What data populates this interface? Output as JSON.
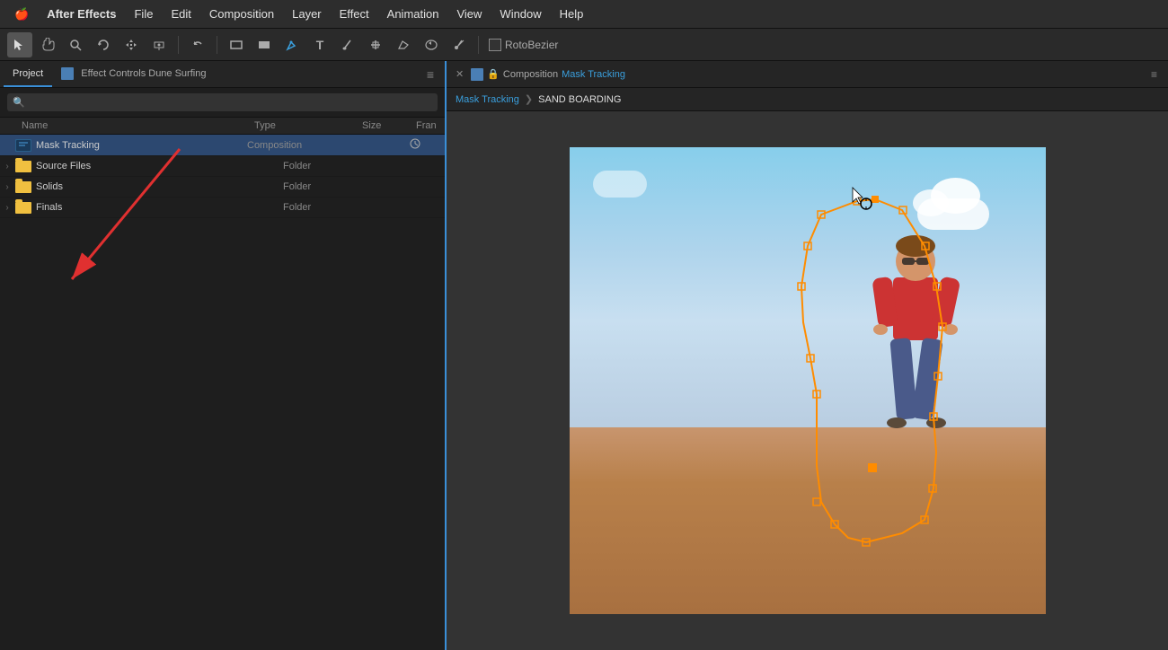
{
  "menubar": {
    "apple": "🍎",
    "app_name": "After Effects",
    "menus": [
      "File",
      "Edit",
      "Composition",
      "Layer",
      "Effect",
      "Animation",
      "View",
      "Window",
      "Help"
    ]
  },
  "toolbar": {
    "tools": [
      {
        "name": "selection-tool",
        "icon": "▲",
        "active": true
      },
      {
        "name": "hand-tool",
        "icon": "✋"
      },
      {
        "name": "zoom-tool",
        "icon": "🔍"
      },
      {
        "name": "rotate-tool",
        "icon": "↺"
      },
      {
        "name": "pan-tool",
        "icon": "✛"
      },
      {
        "name": "camera-tool",
        "icon": "⬇"
      },
      {
        "name": "undo-tool",
        "icon": "↩"
      },
      {
        "name": "rect-tool",
        "icon": "⬜"
      },
      {
        "name": "shape-tool",
        "icon": "◼"
      },
      {
        "name": "pen-tool",
        "icon": "✒"
      },
      {
        "name": "text-tool",
        "icon": "T"
      },
      {
        "name": "brush-tool",
        "icon": "/"
      },
      {
        "name": "clone-tool",
        "icon": "⌅"
      },
      {
        "name": "eraser-tool",
        "icon": "◇"
      },
      {
        "name": "roto-tool",
        "icon": "✦"
      },
      {
        "name": "pin-tool",
        "icon": "📌"
      }
    ],
    "roto_bezier": {
      "label": "RotoBezier",
      "checked": false
    }
  },
  "left_panel": {
    "tabs": [
      {
        "id": "project",
        "label": "Project",
        "active": true
      },
      {
        "id": "effect-controls",
        "label": "Effect Controls Dune Surfing"
      }
    ],
    "project": {
      "search_placeholder": "🔍",
      "columns": {
        "name": "Name",
        "type": "Type",
        "size": "Size",
        "fran": "Fran"
      },
      "items": [
        {
          "id": "mask-tracking",
          "name": "Mask Tracking",
          "type": "Composition",
          "type_color": "blue",
          "size": "",
          "expand": false,
          "has_link": true
        },
        {
          "id": "source-files",
          "name": "Source Files",
          "type": "Folder",
          "type_color": "yellow",
          "size": "",
          "expand": true
        },
        {
          "id": "solids",
          "name": "Solids",
          "type": "Folder",
          "type_color": "yellow",
          "size": "",
          "expand": true
        },
        {
          "id": "finals",
          "name": "Finals",
          "type": "Folder",
          "type_color": "yellow",
          "size": "",
          "expand": true
        }
      ]
    }
  },
  "right_panel": {
    "tab": {
      "close": "✕",
      "comp_label": "Composition",
      "comp_name": "Mask Tracking"
    },
    "breadcrumb": {
      "items": [
        "Mask Tracking"
      ],
      "separator": "❯",
      "current": "SAND BOARDING"
    },
    "viewer": {
      "has_person": true,
      "has_mask": true
    }
  },
  "colors": {
    "accent_blue": "#3a8fd8",
    "mask_orange": "#ff8c00",
    "sky_top": "#87ceeb",
    "sky_bottom": "#d4e9f7",
    "sand": "#c49050"
  }
}
